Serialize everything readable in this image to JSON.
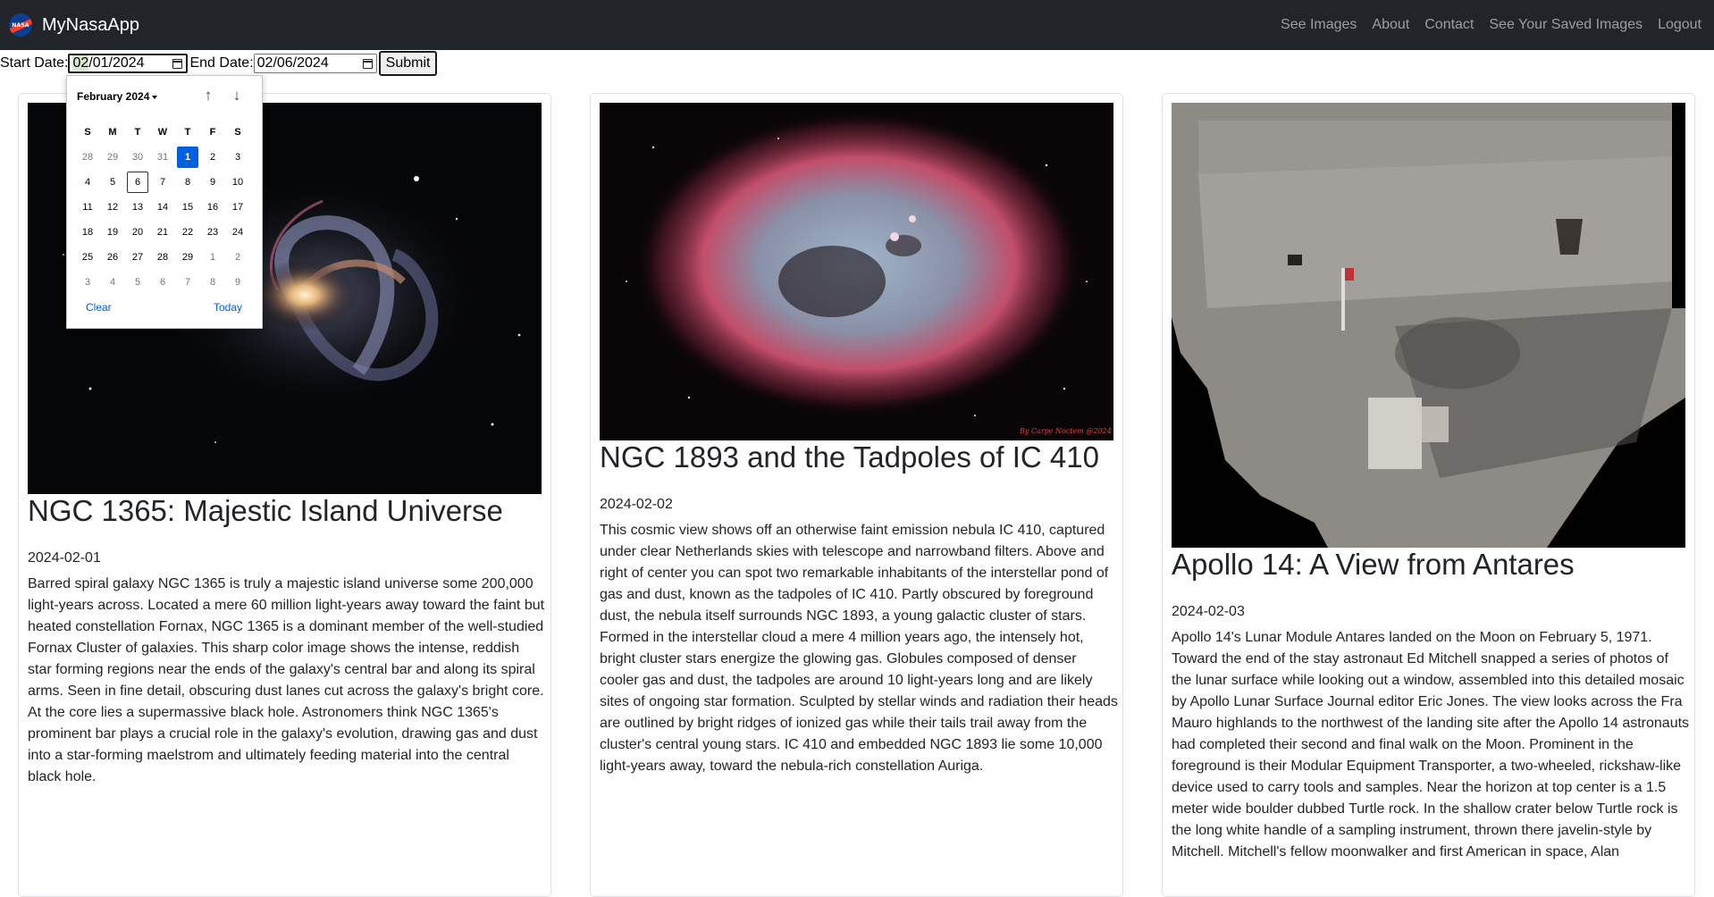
{
  "navbar": {
    "logo_icon": "nasa-logo-icon",
    "logo_text": "NASA",
    "brand": "MyNasaApp",
    "links": [
      "See Images",
      "About",
      "Contact",
      "See Your Saved Images",
      "Logout"
    ]
  },
  "form": {
    "start_label": "Start Date:",
    "start_value_hl": "02",
    "start_value_rest": "/01/2024",
    "end_label": "End Date:",
    "end_value": "02/06/2024",
    "submit_label": "Submit",
    "calendar_icon": "calendar-icon"
  },
  "datepicker": {
    "month_label": "February 2024",
    "up_icon": "arrow-up-icon",
    "down_icon": "arrow-down-icon",
    "weekdays": [
      "S",
      "M",
      "T",
      "W",
      "T",
      "F",
      "S"
    ],
    "days": [
      {
        "d": "28",
        "other": true
      },
      {
        "d": "29",
        "other": true
      },
      {
        "d": "30",
        "other": true
      },
      {
        "d": "31",
        "other": true
      },
      {
        "d": "1",
        "selected": true
      },
      {
        "d": "2"
      },
      {
        "d": "3"
      },
      {
        "d": "4"
      },
      {
        "d": "5"
      },
      {
        "d": "6",
        "today": true
      },
      {
        "d": "7"
      },
      {
        "d": "8"
      },
      {
        "d": "9"
      },
      {
        "d": "10"
      },
      {
        "d": "11"
      },
      {
        "d": "12"
      },
      {
        "d": "13"
      },
      {
        "d": "14"
      },
      {
        "d": "15"
      },
      {
        "d": "16"
      },
      {
        "d": "17"
      },
      {
        "d": "18"
      },
      {
        "d": "19"
      },
      {
        "d": "20"
      },
      {
        "d": "21"
      },
      {
        "d": "22"
      },
      {
        "d": "23"
      },
      {
        "d": "24"
      },
      {
        "d": "25"
      },
      {
        "d": "26"
      },
      {
        "d": "27"
      },
      {
        "d": "28"
      },
      {
        "d": "29"
      },
      {
        "d": "1",
        "other": true
      },
      {
        "d": "2",
        "other": true
      },
      {
        "d": "3",
        "other": true
      },
      {
        "d": "4",
        "other": true
      },
      {
        "d": "5",
        "other": true
      },
      {
        "d": "6",
        "other": true
      },
      {
        "d": "7",
        "other": true
      },
      {
        "d": "8",
        "other": true
      },
      {
        "d": "9",
        "other": true
      }
    ],
    "clear_label": "Clear",
    "today_label": "Today"
  },
  "cards": [
    {
      "title": "NGC 1365: Majestic Island Universe",
      "date": "2024-02-01",
      "text": "Barred spiral galaxy NGC 1365 is truly a majestic island universe some 200,000 light-years across. Located a mere 60 million light-years away toward the faint but heated constellation Fornax, NGC 1365 is a dominant member of the well-studied Fornax Cluster of galaxies. This sharp color image shows the intense, reddish star forming regions near the ends of the galaxy's central bar and along its spiral arms. Seen in fine detail, obscuring dust lanes cut across the galaxy's bright core. At the core lies a supermassive black hole. Astronomers think NGC 1365's prominent bar plays a crucial role in the galaxy's evolution, drawing gas and dust into a star-forming maelstrom and ultimately feeding material into the central black hole.",
      "image": "spiral-galaxy-image"
    },
    {
      "title": "NGC 1893 and the Tadpoles of IC 410",
      "date": "2024-02-02",
      "text": "This cosmic view shows off an otherwise faint emission nebula IC 410, captured under clear Netherlands skies with telescope and narrowband filters. Above and right of center you can spot two remarkable inhabitants of the interstellar pond of gas and dust, known as the tadpoles of IC 410. Partly obscured by foreground dust, the nebula itself surrounds NGC 1893, a young galactic cluster of stars. Formed in the interstellar cloud a mere 4 million years ago, the intensely hot, bright cluster stars energize the glowing gas. Globules composed of denser cooler gas and dust, the tadpoles are around 10 light-years long and are likely sites of ongoing star formation. Sculpted by stellar winds and radiation their heads are outlined by bright ridges of ionized gas while their tails trail away from the cluster's central young stars. IC 410 and embedded NGC 1893 lie some 10,000 light-years away, toward the nebula-rich constellation Auriga.",
      "image": "nebula-image",
      "image_credit": "By Carpe Noctem @2024"
    },
    {
      "title": "Apollo 14: A View from Antares",
      "date": "2024-02-03",
      "text": "Apollo 14's Lunar Module Antares landed on the Moon on February 5, 1971. Toward the end of the stay astronaut Ed Mitchell snapped a series of photos of the lunar surface while looking out a window, assembled into this detailed mosaic by Apollo Lunar Surface Journal editor Eric Jones. The view looks across the Fra Mauro highlands to the northwest of the landing site after the Apollo 14 astronauts had completed their second and final walk on the Moon. Prominent in the foreground is their Modular Equipment Transporter, a two-wheeled, rickshaw-like device used to carry tools and samples. Near the horizon at top center is a 1.5 meter wide boulder dubbed Turtle rock. In the shallow crater below Turtle rock is the long white handle of a sampling instrument, thrown there javelin-style by Mitchell. Mitchell's fellow moonwalker and first American in space, Alan",
      "image": "lunar-surface-image"
    }
  ]
}
